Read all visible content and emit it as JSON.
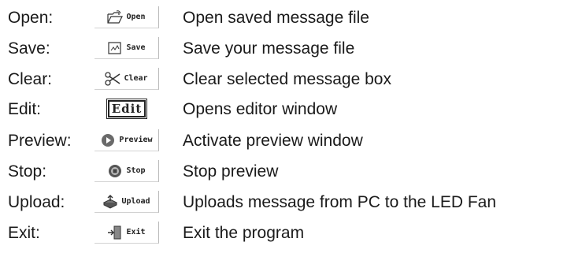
{
  "rows": [
    {
      "label": "Open:",
      "button": "Open",
      "icon": "folder-open-icon",
      "description": "Open saved message file"
    },
    {
      "label": "Save:",
      "button": "Save",
      "icon": "save-document-icon",
      "description": "Save your message file"
    },
    {
      "label": "Clear:",
      "button": "Clear",
      "icon": "scissors-icon",
      "description": "Clear selected message box"
    },
    {
      "label": "Edit:",
      "button": "Edit",
      "icon": "",
      "description": "Opens editor window"
    },
    {
      "label": "Preview:",
      "button": "Preview",
      "icon": "play-icon",
      "description": "Activate preview window"
    },
    {
      "label": "Stop:",
      "button": "Stop",
      "icon": "stop-icon",
      "description": "Stop preview"
    },
    {
      "label": "Upload:",
      "button": "Upload",
      "icon": "upload-icon",
      "description": "Uploads message from PC to the LED Fan"
    },
    {
      "label": "Exit:",
      "button": "Exit",
      "icon": "exit-door-icon",
      "description": "Exit the program"
    }
  ]
}
